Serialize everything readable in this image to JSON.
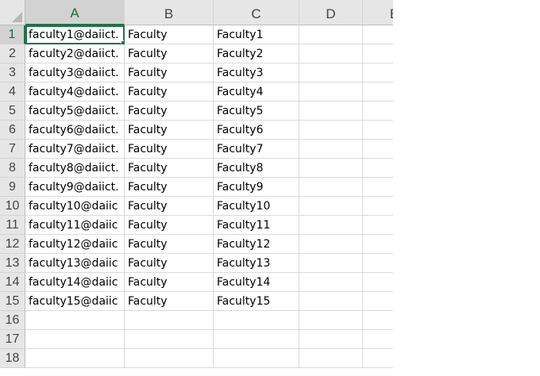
{
  "columns": [
    "A",
    "B",
    "C",
    "D",
    "E"
  ],
  "row_numbers": [
    "1",
    "2",
    "3",
    "4",
    "5",
    "6",
    "7",
    "8",
    "9",
    "10",
    "11",
    "12",
    "13",
    "14",
    "15",
    "16",
    "17",
    "18"
  ],
  "rows": [
    [
      "faculty1@daiict.",
      "Faculty",
      "Faculty1",
      "",
      ""
    ],
    [
      "faculty2@daiict.",
      "Faculty",
      "Faculty2",
      "",
      ""
    ],
    [
      "faculty3@daiict.",
      "Faculty",
      "Faculty3",
      "",
      ""
    ],
    [
      "faculty4@daiict.",
      "Faculty",
      "Faculty4",
      "",
      ""
    ],
    [
      "faculty5@daiict.",
      "Faculty",
      "Faculty5",
      "",
      ""
    ],
    [
      "faculty6@daiict.",
      "Faculty",
      "Faculty6",
      "",
      ""
    ],
    [
      "faculty7@daiict.",
      "Faculty",
      "Faculty7",
      "",
      ""
    ],
    [
      "faculty8@daiict.",
      "Faculty",
      "Faculty8",
      "",
      ""
    ],
    [
      "faculty9@daiict.",
      "Faculty",
      "Faculty9",
      "",
      ""
    ],
    [
      "faculty10@daiic",
      "Faculty",
      "Faculty10",
      "",
      ""
    ],
    [
      "faculty11@daiic",
      "Faculty",
      "Faculty11",
      "",
      ""
    ],
    [
      "faculty12@daiic",
      "Faculty",
      "Faculty12",
      "",
      ""
    ],
    [
      "faculty13@daiic",
      "Faculty",
      "Faculty13",
      "",
      ""
    ],
    [
      "faculty14@daiic",
      "Faculty",
      "Faculty14",
      "",
      ""
    ],
    [
      "faculty15@daiic",
      "Faculty",
      "Faculty15",
      "",
      ""
    ],
    [
      "",
      "",
      "",
      "",
      ""
    ],
    [
      "",
      "",
      "",
      "",
      ""
    ],
    [
      "",
      "",
      "",
      "",
      ""
    ]
  ],
  "selection": {
    "active_cell": "A1"
  },
  "colors": {
    "accent": "#217346",
    "header_bg": "#e6e6e6",
    "gridline": "#dadada"
  }
}
